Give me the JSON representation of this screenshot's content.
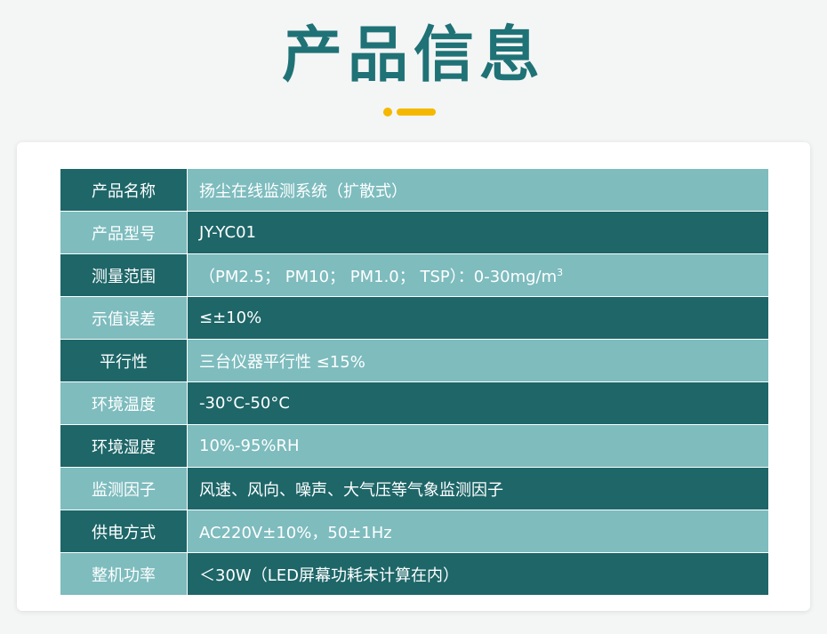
{
  "page": {
    "title": "产品信息"
  },
  "specs": [
    {
      "label": "产品名称",
      "value": "扬尘在线监测系统（扩散式）"
    },
    {
      "label": "产品型号",
      "value": "JY-YC01"
    },
    {
      "label": "测量范围",
      "value": "（PM2.5； PM10； PM1.0； TSP）：0-30mg/m",
      "value_sup": "3"
    },
    {
      "label": "示值误差",
      "value": "≤±10%"
    },
    {
      "label": "平行性",
      "value": "三台仪器平行性 ≤15%"
    },
    {
      "label": "环境温度",
      "value": "-30°C-50°C"
    },
    {
      "label": "环境湿度",
      "value": "10%-95%RH"
    },
    {
      "label": "监测因子",
      "value": "风速、风向、噪声、大气压等气象监测因子"
    },
    {
      "label": "供电方式",
      "value": "AC220V±10%，50±1Hz"
    },
    {
      "label": "整机功率",
      "value": "＜30W（LED屏幕功耗未计算在内）"
    }
  ],
  "colors": {
    "title": "#1f7276",
    "accent": "#f5b800",
    "row_dark": "#1e6668",
    "row_light": "#7ebcbe"
  }
}
